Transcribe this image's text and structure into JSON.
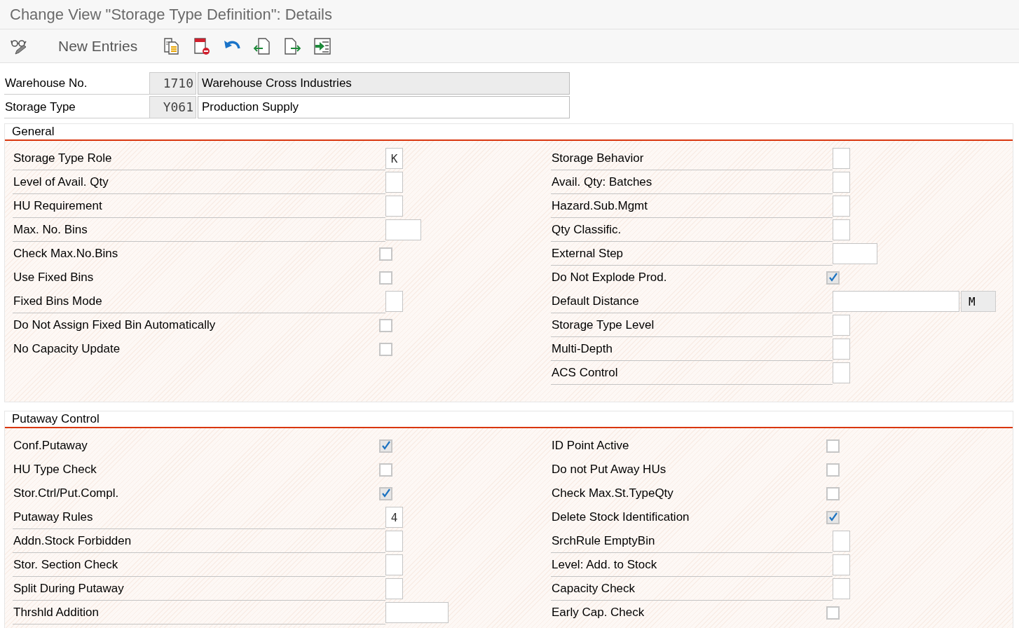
{
  "window": {
    "title": "Change View \"Storage Type Definition\": Details"
  },
  "toolbar": {
    "items": [
      {
        "kind": "display-toggle"
      },
      {
        "kind": "text",
        "label": "New Entries"
      },
      {
        "kind": "copy"
      },
      {
        "kind": "delete"
      },
      {
        "kind": "undo"
      },
      {
        "kind": "previous"
      },
      {
        "kind": "next"
      },
      {
        "kind": "select"
      }
    ]
  },
  "header_fields": [
    {
      "label": "Warehouse No.",
      "code": "1710",
      "description": "Warehouse Cross Industries",
      "editable": false
    },
    {
      "label": "Storage Type",
      "code": "Y061",
      "description": "Production Supply",
      "editable": true
    }
  ],
  "sections": [
    {
      "title": "General",
      "columns": [
        [
          {
            "label": "Storage Type Role",
            "kind": "char",
            "value": "K"
          },
          {
            "label": "Level of Avail. Qty",
            "kind": "char"
          },
          {
            "label": "HU Requirement",
            "kind": "char"
          },
          {
            "label": "Max. No. Bins",
            "kind": "short"
          },
          {
            "label": "Check Max.No.Bins",
            "kind": "checkbox",
            "checked": false
          },
          {
            "label": "Use Fixed Bins",
            "kind": "checkbox",
            "checked": false
          },
          {
            "label": "Fixed Bins Mode",
            "kind": "char"
          },
          {
            "label": "Do Not Assign Fixed Bin Automatically",
            "kind": "checkbox",
            "checked": false
          },
          {
            "label": "No Capacity Update",
            "kind": "checkbox",
            "checked": false
          }
        ],
        [
          {
            "label": "Storage Behavior",
            "kind": "char"
          },
          {
            "label": "Avail. Qty: Batches",
            "kind": "char"
          },
          {
            "label": "Hazard.Sub.Mgmt",
            "kind": "char"
          },
          {
            "label": "Qty Classific.",
            "kind": "char"
          },
          {
            "label": "External Step",
            "kind": "medium"
          },
          {
            "label": "Do Not Explode Prod.",
            "kind": "checkbox",
            "checked": true
          },
          {
            "label": "Default Distance",
            "kind": "wide",
            "unit": "M"
          },
          {
            "label": "Storage Type Level",
            "kind": "char"
          },
          {
            "label": "Multi-Depth",
            "kind": "char"
          },
          {
            "label": "ACS Control",
            "kind": "char"
          }
        ]
      ]
    },
    {
      "title": "Putaway Control",
      "columns": [
        [
          {
            "label": "Conf.Putaway",
            "kind": "checkbox",
            "checked": true
          },
          {
            "label": "HU Type Check",
            "kind": "checkbox",
            "checked": false
          },
          {
            "label": "Stor.Ctrl/Put.Compl.",
            "kind": "checkbox",
            "checked": true
          },
          {
            "label": "Putaway Rules",
            "kind": "char",
            "value": "4"
          },
          {
            "label": "Addn.Stock Forbidden",
            "kind": "char"
          },
          {
            "label": "Stor. Section Check",
            "kind": "char"
          },
          {
            "label": "Split During Putaway",
            "kind": "char"
          },
          {
            "label": "Thrshld Addition",
            "kind": "long"
          }
        ],
        [
          {
            "label": "ID Point Active",
            "kind": "checkbox",
            "checked": false
          },
          {
            "label": "Do not Put Away HUs",
            "kind": "checkbox",
            "checked": false
          },
          {
            "label": "Check Max.St.TypeQty",
            "kind": "checkbox",
            "checked": false
          },
          {
            "label": "Delete Stock Identification",
            "kind": "checkbox",
            "checked": true
          },
          {
            "label": "SrchRule EmptyBin",
            "kind": "char"
          },
          {
            "label": "Level: Add. to Stock",
            "kind": "char"
          },
          {
            "label": "Capacity Check",
            "kind": "char"
          },
          {
            "label": "Early Cap. Check",
            "kind": "checkbox",
            "checked": false
          }
        ]
      ]
    }
  ]
}
